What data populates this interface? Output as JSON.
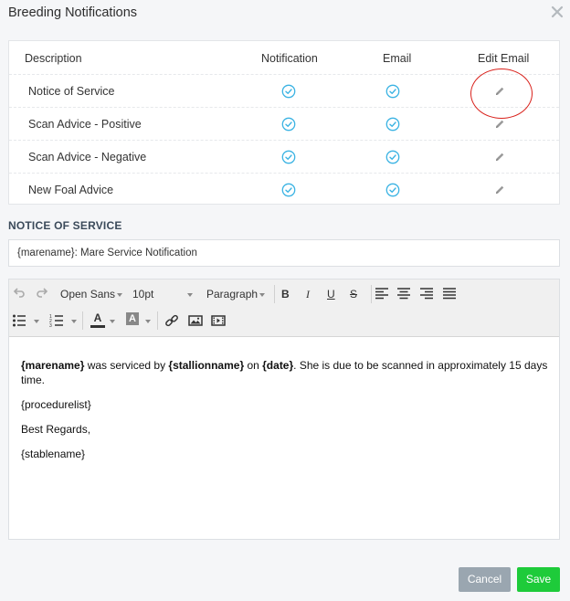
{
  "dialog": {
    "title": "Breeding Notifications"
  },
  "table": {
    "headers": {
      "description": "Description",
      "notification": "Notification",
      "email": "Email",
      "edit_email": "Edit Email"
    },
    "rows": [
      {
        "description": "Notice of Service",
        "notification": true,
        "email": true
      },
      {
        "description": "Scan Advice - Positive",
        "notification": true,
        "email": true
      },
      {
        "description": "Scan Advice - Negative",
        "notification": true,
        "email": true
      },
      {
        "description": "New Foal Advice",
        "notification": true,
        "email": true
      }
    ]
  },
  "section_title": "NOTICE OF SERVICE",
  "subject": {
    "value": "{marename}: Mare Service Notification"
  },
  "toolbar": {
    "font_family": "Open Sans",
    "font_size": "10pt",
    "block_format": "Paragraph",
    "bold": "B",
    "italic": "I",
    "underline": "U",
    "strike": "S",
    "text_color": "A",
    "bg_color": "A"
  },
  "body": {
    "line1": {
      "marename": "{marename}",
      "t1": " was serviced by ",
      "stallion": "{stallionname}",
      "t2": " on ",
      "date": "{date}",
      "t3": ". She is due to be scanned in approximately 15 days time."
    },
    "procedurelist": "{procedurelist}",
    "regards": "Best Regards,",
    "stablename": "{stablename}"
  },
  "buttons": {
    "cancel": "Cancel",
    "save": "Save"
  },
  "colors": {
    "check": "#3bb3e3",
    "save": "#1ecb3a",
    "cancel": "#9aa6b0",
    "annotation": "#d9221c"
  }
}
